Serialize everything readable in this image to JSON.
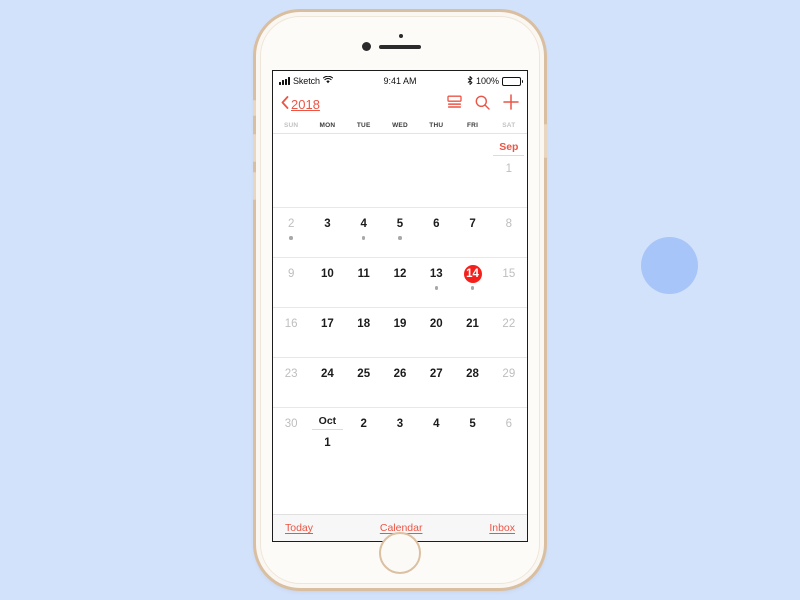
{
  "background": {
    "page_color": "#D3E2FB",
    "circle_color": "#A7C5F8"
  },
  "device": {
    "name": "iphone-gold",
    "body_color": "#FAF7F2",
    "frame_color": "#D9BFA0"
  },
  "status_bar": {
    "carrier": "Sketch",
    "signal_icon": "signal-bars-icon",
    "wifi_icon": "wifi-icon",
    "time": "9:41 AM",
    "bluetooth_icon": "bluetooth-icon",
    "battery_percent": "100%",
    "battery_icon": "battery-full-icon"
  },
  "nav_bar": {
    "back_chevron_icon": "chevron-left-icon",
    "back_label": "2018",
    "actions": [
      {
        "icon": "day-view-icon",
        "name": "day-view-button"
      },
      {
        "icon": "search-icon",
        "name": "search-button"
      },
      {
        "icon": "plus-icon",
        "name": "add-event-button"
      }
    ],
    "accent_color": "#EB5545"
  },
  "weekdays": [
    {
      "label": "SUN",
      "weekend": true
    },
    {
      "label": "MON",
      "weekend": false
    },
    {
      "label": "TUE",
      "weekend": false
    },
    {
      "label": "WED",
      "weekend": false
    },
    {
      "label": "THU",
      "weekend": false
    },
    {
      "label": "FRI",
      "weekend": false
    },
    {
      "label": "SAT",
      "weekend": true
    }
  ],
  "calendar": {
    "selected_color": "#F5201B",
    "month_labels": {
      "sep": "Sep",
      "oct": "Oct"
    },
    "weeks": [
      {
        "height": "tall",
        "days": [
          {
            "label": "",
            "empty": true
          },
          {
            "label": "",
            "empty": true
          },
          {
            "label": "",
            "empty": true
          },
          {
            "label": "",
            "empty": true
          },
          {
            "label": "",
            "empty": true
          },
          {
            "label": "",
            "empty": true
          },
          {
            "label": "1",
            "dim": true,
            "month_label": "Sep",
            "month_class": "sep"
          }
        ]
      },
      {
        "height": "normal",
        "days": [
          {
            "label": "2",
            "dim": true,
            "dot": true
          },
          {
            "label": "3",
            "dim": false
          },
          {
            "label": "4",
            "dim": false,
            "dot": true
          },
          {
            "label": "5",
            "dim": false,
            "dot": true
          },
          {
            "label": "6",
            "dim": false
          },
          {
            "label": "7",
            "dim": false
          },
          {
            "label": "8",
            "dim": true
          }
        ]
      },
      {
        "height": "normal",
        "days": [
          {
            "label": "9",
            "dim": true
          },
          {
            "label": "10",
            "dim": false
          },
          {
            "label": "11",
            "dim": false
          },
          {
            "label": "12",
            "dim": false
          },
          {
            "label": "13",
            "dim": false,
            "dot": true
          },
          {
            "label": "14",
            "dim": false,
            "dot": true,
            "selected": true
          },
          {
            "label": "15",
            "dim": true
          }
        ]
      },
      {
        "height": "normal",
        "days": [
          {
            "label": "16",
            "dim": true
          },
          {
            "label": "17",
            "dim": false
          },
          {
            "label": "18",
            "dim": false
          },
          {
            "label": "19",
            "dim": false
          },
          {
            "label": "20",
            "dim": false
          },
          {
            "label": "21",
            "dim": false
          },
          {
            "label": "22",
            "dim": true
          }
        ]
      },
      {
        "height": "normal",
        "days": [
          {
            "label": "23",
            "dim": true
          },
          {
            "label": "24",
            "dim": false
          },
          {
            "label": "25",
            "dim": false
          },
          {
            "label": "26",
            "dim": false
          },
          {
            "label": "27",
            "dim": false
          },
          {
            "label": "28",
            "dim": false
          },
          {
            "label": "29",
            "dim": true
          }
        ]
      },
      {
        "height": "tall",
        "last": true,
        "days": [
          {
            "label": "30",
            "dim": true
          },
          {
            "label": "1",
            "dim": false,
            "month_label": "Oct",
            "month_class": "oct"
          },
          {
            "label": "2",
            "dim": false
          },
          {
            "label": "3",
            "dim": false
          },
          {
            "label": "4",
            "dim": false
          },
          {
            "label": "5",
            "dim": false
          },
          {
            "label": "6",
            "dim": true
          }
        ]
      }
    ]
  },
  "toolbar": {
    "today_label": "Today",
    "calendar_label": "Calendar",
    "inbox_label": "Inbox"
  }
}
